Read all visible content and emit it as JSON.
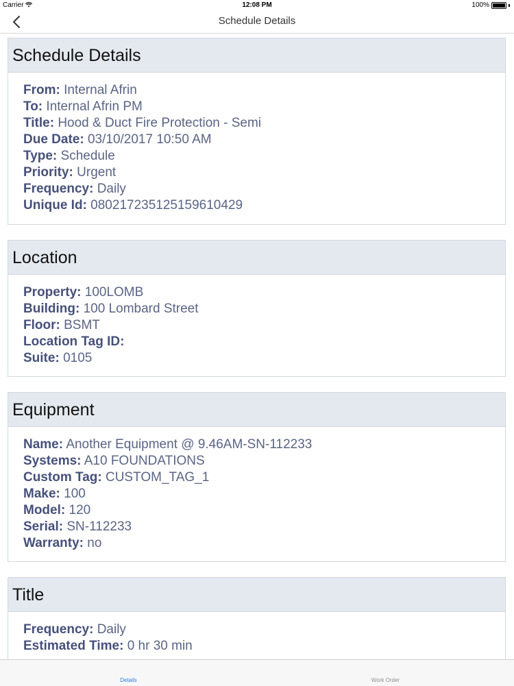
{
  "status_bar": {
    "carrier": "Carrier",
    "time": "12:08 PM",
    "battery": "100%"
  },
  "nav": {
    "title": "Schedule Details"
  },
  "sections": {
    "schedule": {
      "header": "Schedule Details",
      "from": {
        "label": "From:",
        "value": "Internal Afrin"
      },
      "to": {
        "label": "To:",
        "value": "Internal Afrin PM"
      },
      "title": {
        "label": "Title:",
        "value": "Hood & Duct Fire Protection - Semi"
      },
      "due_date": {
        "label": "Due Date:",
        "value": "03/10/2017 10:50 AM"
      },
      "type": {
        "label": "Type:",
        "value": "Schedule"
      },
      "priority": {
        "label": "Priority:",
        "value": "Urgent"
      },
      "frequency": {
        "label": "Frequency:",
        "value": "Daily"
      },
      "unique_id": {
        "label": "Unique Id:",
        "value": "080217235125159610429"
      }
    },
    "location": {
      "header": "Location",
      "property": {
        "label": "Property:",
        "value": "100LOMB"
      },
      "building": {
        "label": "Building:",
        "value": "100 Lombard Street"
      },
      "floor": {
        "label": "Floor:",
        "value": "BSMT"
      },
      "location_tag": {
        "label": "Location Tag ID:",
        "value": ""
      },
      "suite": {
        "label": "Suite:",
        "value": "0105"
      }
    },
    "equipment": {
      "header": "Equipment",
      "name": {
        "label": "Name:",
        "value": "Another Equipment @ 9.46AM-SN-112233"
      },
      "systems": {
        "label": "Systems:",
        "value": "A10 FOUNDATIONS"
      },
      "custom_tag": {
        "label": "Custom Tag:",
        "value": "CUSTOM_TAG_1"
      },
      "make": {
        "label": "Make:",
        "value": "100"
      },
      "model": {
        "label": "Model:",
        "value": "120"
      },
      "serial": {
        "label": "Serial:",
        "value": "SN-112233"
      },
      "warranty": {
        "label": "Warranty:",
        "value": "no"
      }
    },
    "title_section": {
      "header": "Title",
      "frequency": {
        "label": "Frequency:",
        "value": "Daily"
      },
      "estimated_time": {
        "label": "Estimated Time:",
        "value": "0 hr 30 min"
      }
    }
  },
  "tabs": [
    {
      "label": "Details"
    },
    {
      "label": "Work Order"
    }
  ],
  "colors": {
    "accent": "#2f7ae5",
    "section_header_bg": "#e3e9ef",
    "label_text": "#46507a",
    "value_text": "#5a6485"
  }
}
